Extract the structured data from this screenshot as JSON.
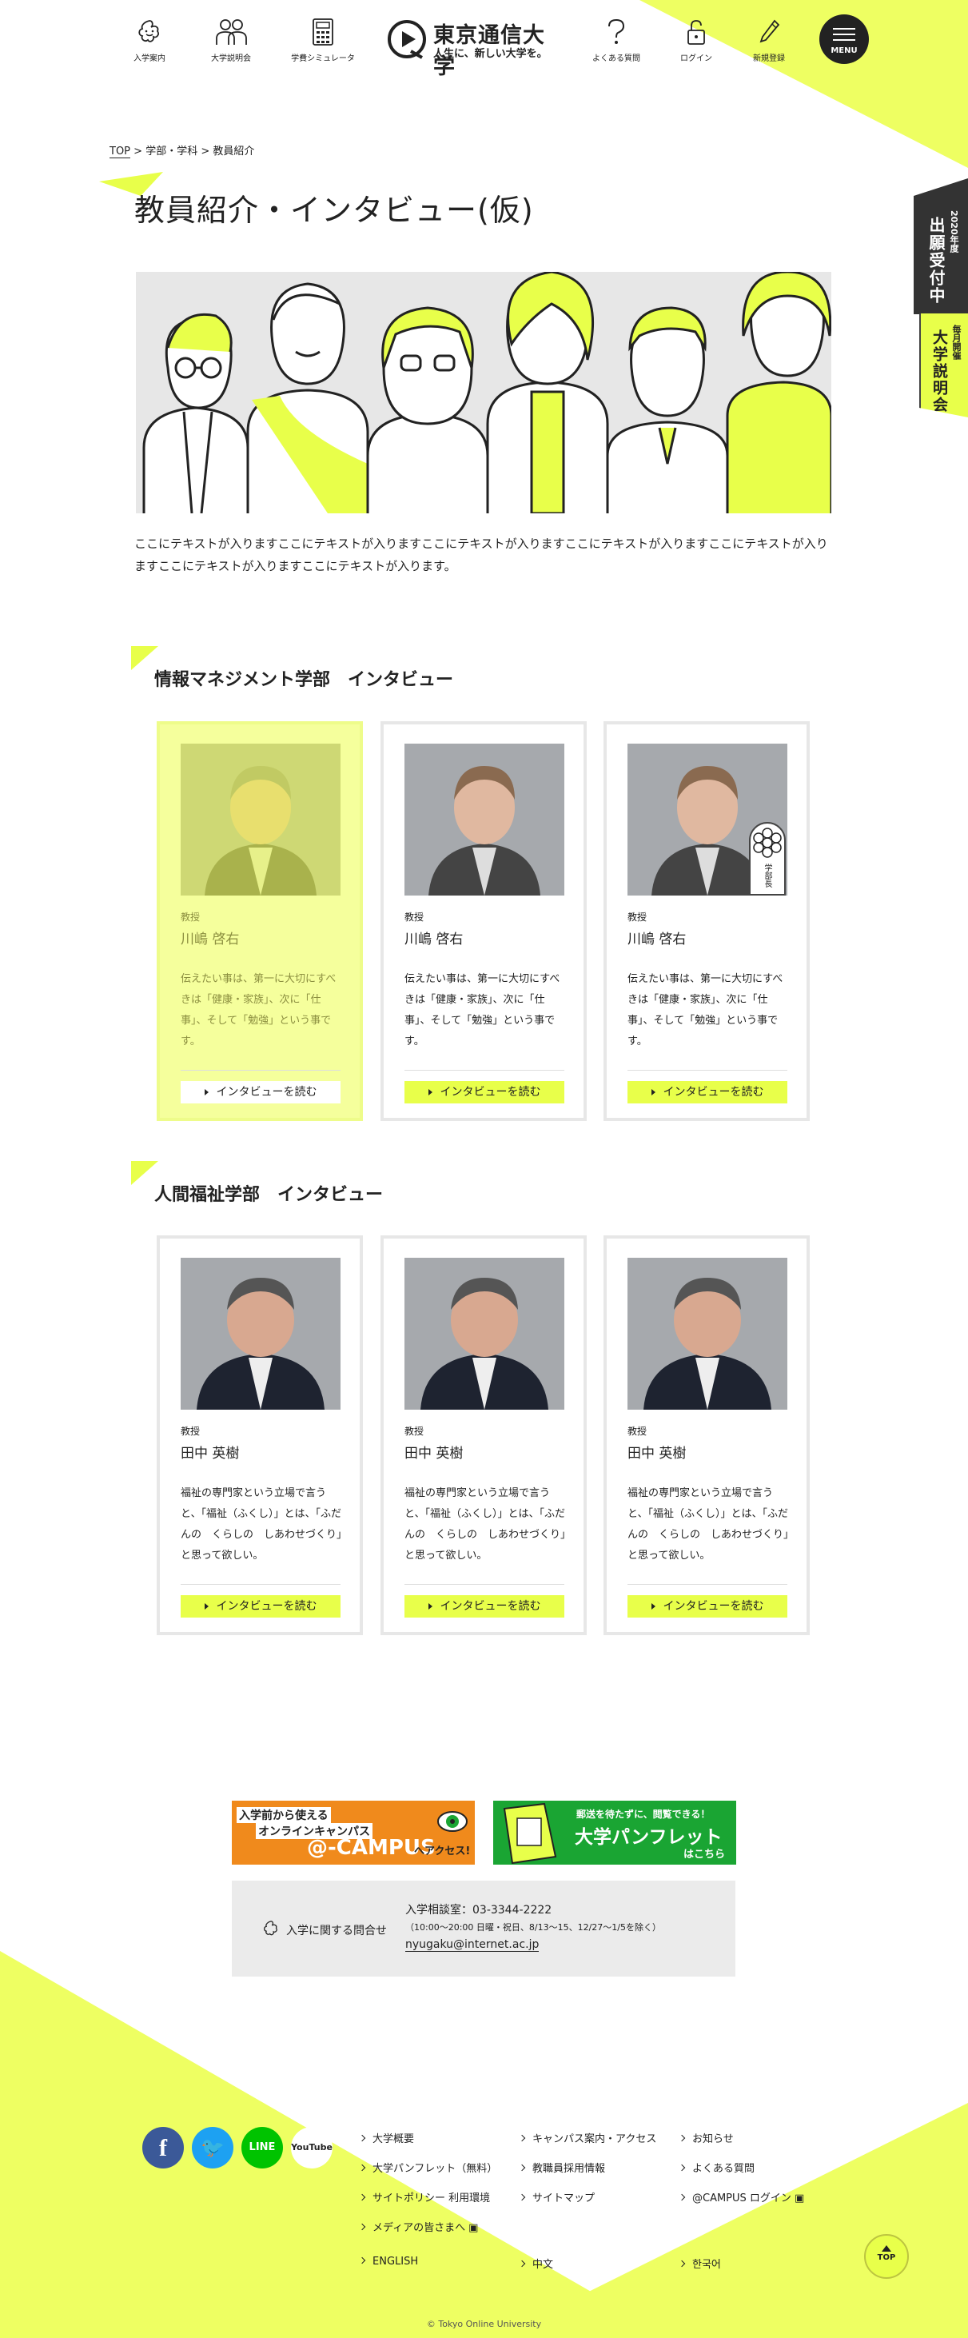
{
  "header": {
    "nav": [
      {
        "label": "入学案内",
        "icon": "flower-icon"
      },
      {
        "label": "大学説明会",
        "icon": "people-icon"
      },
      {
        "label": "学費シミュレータ",
        "icon": "calculator-icon"
      },
      {
        "label": "よくある質問",
        "icon": "question-icon"
      },
      {
        "label": "ログイン",
        "icon": "lock-icon"
      },
      {
        "label": "新規登録",
        "icon": "pencil-icon"
      }
    ],
    "logo_main": "東京通信大学",
    "logo_sub": "人生に、新しい大学を。",
    "menu_label": "MENU"
  },
  "side_tabs": {
    "application_year": "2020年度",
    "application_label": "出願受付中",
    "briefing_top": "毎月開催",
    "briefing_label": "大学説明会"
  },
  "breadcrumb": {
    "top": "TOP",
    "sep1": " > ",
    "middle": "学部・学科",
    "sep2": " > ",
    "current": "教員紹介"
  },
  "page_title": "教員紹介・インタビュー(仮)",
  "intro_text": "ここにテキストが入りますここにテキストが入りますここにテキストが入りますここにテキストが入りますここにテキストが入りますここにテキストが入りますここにテキストが入ります。",
  "sections": [
    {
      "title": "情報マネジメント学部　インタビュー",
      "cards": [
        {
          "role": "教授",
          "name": "川嶋 啓右",
          "desc": "伝えたい事は、第一に大切にすべきは「健康・家族」、次に「仕事」、そして「勉強」という事です。",
          "button": "インタビューを読む",
          "badge": ""
        },
        {
          "role": "教授",
          "name": "川嶋 啓右",
          "desc": "伝えたい事は、第一に大切にすべきは「健康・家族」、次に「仕事」、そして「勉強」という事です。",
          "button": "インタビューを読む",
          "badge": ""
        },
        {
          "role": "教授",
          "name": "川嶋 啓右",
          "desc": "伝えたい事は、第一に大切にすべきは「健康・家族」、次に「仕事」、そして「勉強」という事です。",
          "button": "インタビューを読む",
          "badge": "学部長"
        }
      ]
    },
    {
      "title": "人間福祉学部　インタビュー",
      "cards": [
        {
          "role": "教授",
          "name": "田中 英樹",
          "desc": "福祉の専門家という立場で言うと、「福祉（ふくし）」とは、「ふだんの　くらしの　しあわせづくり」と思って欲しい。",
          "button": "インタビューを読む"
        },
        {
          "role": "教授",
          "name": "田中 英樹",
          "desc": "福祉の専門家という立場で言うと、「福祉（ふくし）」とは、「ふだんの　くらしの　しあわせづくり」と思って欲しい。",
          "button": "インタビューを読む"
        },
        {
          "role": "教授",
          "name": "田中 英樹",
          "desc": "福祉の専門家という立場で言うと、「福祉（ふくし）」とは、「ふだんの　くらしの　しあわせづくり」と思って欲しい。",
          "button": "インタビューを読む"
        }
      ]
    }
  ],
  "banners": {
    "campus_line1": "入学前から使える",
    "campus_line2": "オンラインキャンパス",
    "campus_main": "@-CAMPUS",
    "campus_sub": "へアクセス!",
    "pamph_top": "郵送を待たずに、閲覧できる！",
    "pamph_main": "大学パンフレット",
    "pamph_sub": "はこちら"
  },
  "contact": {
    "label": "入学に関する問合せ",
    "phone": "入学相談室：03-3344-2222",
    "hours": "（10:00〜20:00 日曜・祝日、8/13〜15、12/27〜1/5を除く）",
    "email": "nyugaku@internet.ac.jp"
  },
  "footer": {
    "sns": [
      {
        "label": "f",
        "icon": "facebook-icon",
        "color": "#3b5998"
      },
      {
        "label": "🐦",
        "icon": "twitter-icon",
        "color": "#1da1f2"
      },
      {
        "label": "LINE",
        "icon": "line-icon",
        "color": "#00c300"
      },
      {
        "label": "YouTube",
        "icon": "youtube-icon",
        "color": "#ffffff"
      }
    ],
    "links_col1": [
      "大学概要",
      "大学パンフレット（無料）",
      "サイトポリシー 利用環境",
      "メディアの皆さまへ"
    ],
    "links_col2": [
      "キャンパス案内・アクセス",
      "教職員採用情報",
      "サイトマップ"
    ],
    "links_col3": [
      "お知らせ",
      "よくある質問",
      "@CAMPUS ログイン"
    ],
    "languages": [
      "ENGLISH",
      "中文",
      "한국어"
    ],
    "top_label": "TOP",
    "copyright": "© Tokyo Online University"
  },
  "colors": {
    "accent": "#e8ff4a",
    "dark": "#222222",
    "campus_orange": "#f08a1c",
    "pamph_green": "#1aa533"
  }
}
